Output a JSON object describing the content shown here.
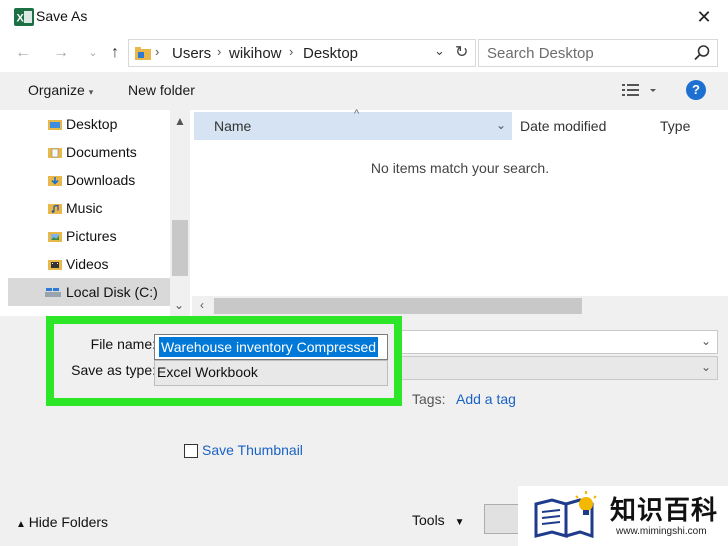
{
  "window": {
    "title": "Save As"
  },
  "address": {
    "path": [
      "Users",
      "wikihow",
      "Desktop"
    ],
    "search_placeholder": "Search Desktop"
  },
  "toolbar": {
    "organize": "Organize",
    "new_folder": "New folder",
    "help": "?"
  },
  "nav_items": [
    {
      "label": "Desktop",
      "icon": "folder-icon"
    },
    {
      "label": "Documents",
      "icon": "documents-icon"
    },
    {
      "label": "Downloads",
      "icon": "downloads-icon"
    },
    {
      "label": "Music",
      "icon": "music-icon"
    },
    {
      "label": "Pictures",
      "icon": "pictures-icon"
    },
    {
      "label": "Videos",
      "icon": "videos-icon"
    },
    {
      "label": "Local Disk (C:)",
      "icon": "drive-icon",
      "selected": true
    }
  ],
  "file_list": {
    "columns": [
      "Name",
      "Date modified",
      "Type"
    ],
    "empty_message": "No items match your search."
  },
  "form": {
    "file_name_label": "File name:",
    "file_name_value": "Warehouse inventory Compressed",
    "save_as_type_label": "Save as type:",
    "save_as_type_value": "Excel Workbook",
    "tags_label": "Tags:",
    "tags_link": "Add a tag",
    "thumbnail_label": "Save Thumbnail"
  },
  "footer": {
    "hide_folders": "Hide Folders",
    "tools": "Tools"
  },
  "watermark": {
    "title": "知识百科",
    "url": "www.mimingshi.com"
  },
  "colors": {
    "highlight": "#2ee628",
    "selection": "#0078d7",
    "link": "#1a62c4",
    "excel": "#1d7044"
  }
}
